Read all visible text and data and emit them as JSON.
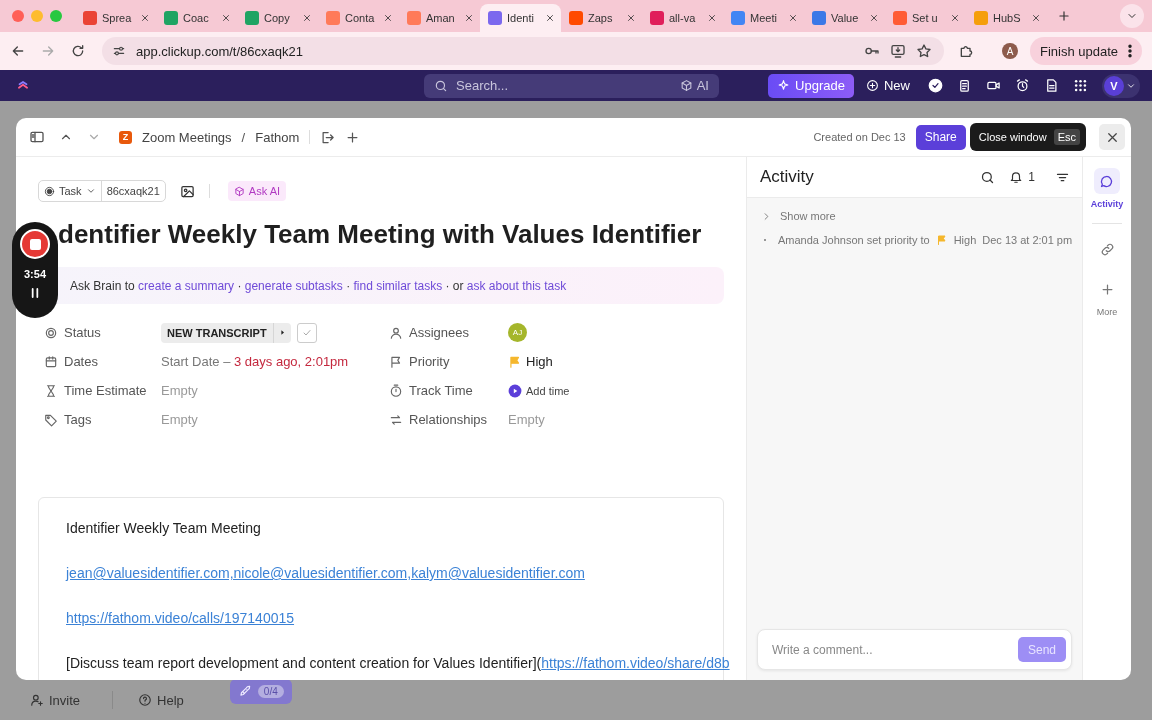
{
  "browser": {
    "tabs": [
      {
        "label": "Sprea",
        "color": "#ea4335",
        "selected": false
      },
      {
        "label": "Coac",
        "color": "#1fa463",
        "selected": false
      },
      {
        "label": "Copy",
        "color": "#1fa463",
        "selected": false
      },
      {
        "label": "Conta",
        "color": "#ff7a59",
        "selected": false
      },
      {
        "label": "Aman",
        "color": "#ff7a59",
        "selected": false
      },
      {
        "label": "Identi",
        "color": "#7b68ee",
        "selected": true
      },
      {
        "label": "Zaps",
        "color": "#ff4a00",
        "selected": false
      },
      {
        "label": "all-va",
        "color": "#e01e5a",
        "selected": false
      },
      {
        "label": "Meeti",
        "color": "#4285f4",
        "selected": false
      },
      {
        "label": "Value",
        "color": "#3b78e7",
        "selected": false
      },
      {
        "label": "Set u",
        "color": "#ff5c35",
        "selected": false
      },
      {
        "label": "HubS",
        "color": "#f59e0b",
        "selected": false
      }
    ],
    "url": "app.clickup.com/t/86cxaqk21",
    "profile_initial": "A",
    "update_button": "Finish update"
  },
  "app_header": {
    "search_placeholder": "Search...",
    "ai_label": "AI",
    "upgrade_button": "Upgrade",
    "new_button": "New",
    "avatar_initial": "V"
  },
  "task": {
    "space_initial": "Z",
    "breadcrumb": [
      "Zoom Meetings",
      "Fathom"
    ],
    "breadcrumb_separator": "/",
    "created": "Created on Dec 13",
    "share_button": "Share",
    "tooltip": {
      "text": "Close window",
      "shortcut": "Esc"
    },
    "type_label": "Task",
    "task_id": "86cxaqk21",
    "ask_ai": "Ask AI",
    "title": "dentifier Weekly Team Meeting with Values Identifier",
    "ask_brain": [
      {
        "kind": "text",
        "text": "Ask Brain to "
      },
      {
        "kind": "link",
        "text": "create a summary"
      },
      {
        "kind": "text",
        "text": " · "
      },
      {
        "kind": "link",
        "text": "generate subtasks"
      },
      {
        "kind": "text",
        "text": " · "
      },
      {
        "kind": "link",
        "text": "find similar tasks"
      },
      {
        "kind": "text",
        "text": " · or "
      },
      {
        "kind": "link",
        "text": "ask about this task"
      }
    ],
    "fields": [
      {
        "kind": "status",
        "label": "Status",
        "value": "NEW TRANSCRIPT"
      },
      {
        "kind": "assignees",
        "label": "Assignees",
        "value": "AJ"
      },
      {
        "kind": "dates",
        "label": "Dates",
        "prefix": "Start Date –",
        "value": "3 days ago, 2:01pm"
      },
      {
        "kind": "priority",
        "label": "Priority",
        "value": "High"
      },
      {
        "kind": "time_estimate",
        "label": "Time Estimate",
        "value": "Empty"
      },
      {
        "kind": "track_time",
        "label": "Track Time",
        "value": "Add time"
      },
      {
        "kind": "tags",
        "label": "Tags",
        "value": "Empty"
      },
      {
        "kind": "relationships",
        "label": "Relationships",
        "value": "Empty"
      }
    ],
    "description": [
      {
        "segments": [
          {
            "kind": "text",
            "text": "Identifier Weekly Team Meeting"
          }
        ]
      },
      {
        "segments": [
          {
            "kind": "link",
            "text": "jean@valuesidentifier.com,nicole@valuesidentifier.com,kalym@valuesidentifier.com"
          }
        ]
      },
      {
        "segments": [
          {
            "kind": "link",
            "text": "https://fathom.video/calls/197140015"
          }
        ]
      },
      {
        "segments": [
          {
            "kind": "text",
            "text": "[Discuss team report development and content creation for Values Identifier]("
          },
          {
            "kind": "link",
            "text": "https://fathom.video/share/d8b"
          }
        ]
      }
    ]
  },
  "recorder": {
    "time": "3:54"
  },
  "activity": {
    "title": "Activity",
    "notification_count": "1",
    "show_more": "Show more",
    "entries": [
      {
        "text": "Amanda Johnson set priority to",
        "value": "High",
        "time": "Dec 13 at 2:01 pm"
      }
    ],
    "comment_placeholder": "Write a comment...",
    "send_button": {
      "label": "Send",
      "disabled": true
    }
  },
  "rail": [
    {
      "kind": "activity",
      "label": "Activity",
      "selected": true
    },
    {
      "kind": "links",
      "selected": false
    },
    {
      "kind": "more",
      "label": "More",
      "selected": false
    }
  ],
  "footer": {
    "invite": "Invite",
    "help": "Help",
    "onboarding_progress": "0/4"
  }
}
